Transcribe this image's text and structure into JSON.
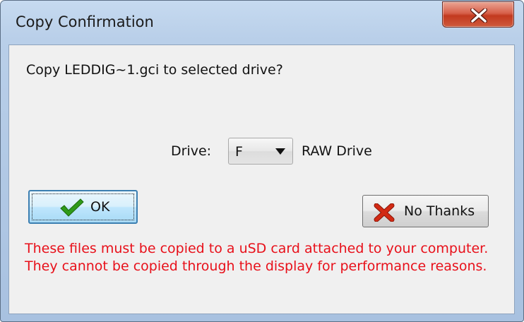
{
  "window": {
    "title": "Copy Confirmation",
    "close_icon": "close-icon"
  },
  "dialog": {
    "message": "Copy LEDDIG~1.gci to selected drive?",
    "drive_label": "Drive:",
    "drive_options_selected": "F",
    "drive_type": "RAW Drive",
    "ok_label": "OK",
    "ok_icon": "checkmark-icon",
    "no_thanks_label": "No Thanks",
    "no_thanks_icon": "red-x-icon",
    "warning": "These files must be copied to a uSD card attached to your computer. They cannot be copied through the display for performance reasons."
  },
  "colors": {
    "warning_text": "#e8101a",
    "close_button": "#c2391f",
    "checkmark": "#2f9a1a",
    "x_icon": "#d22a14"
  }
}
